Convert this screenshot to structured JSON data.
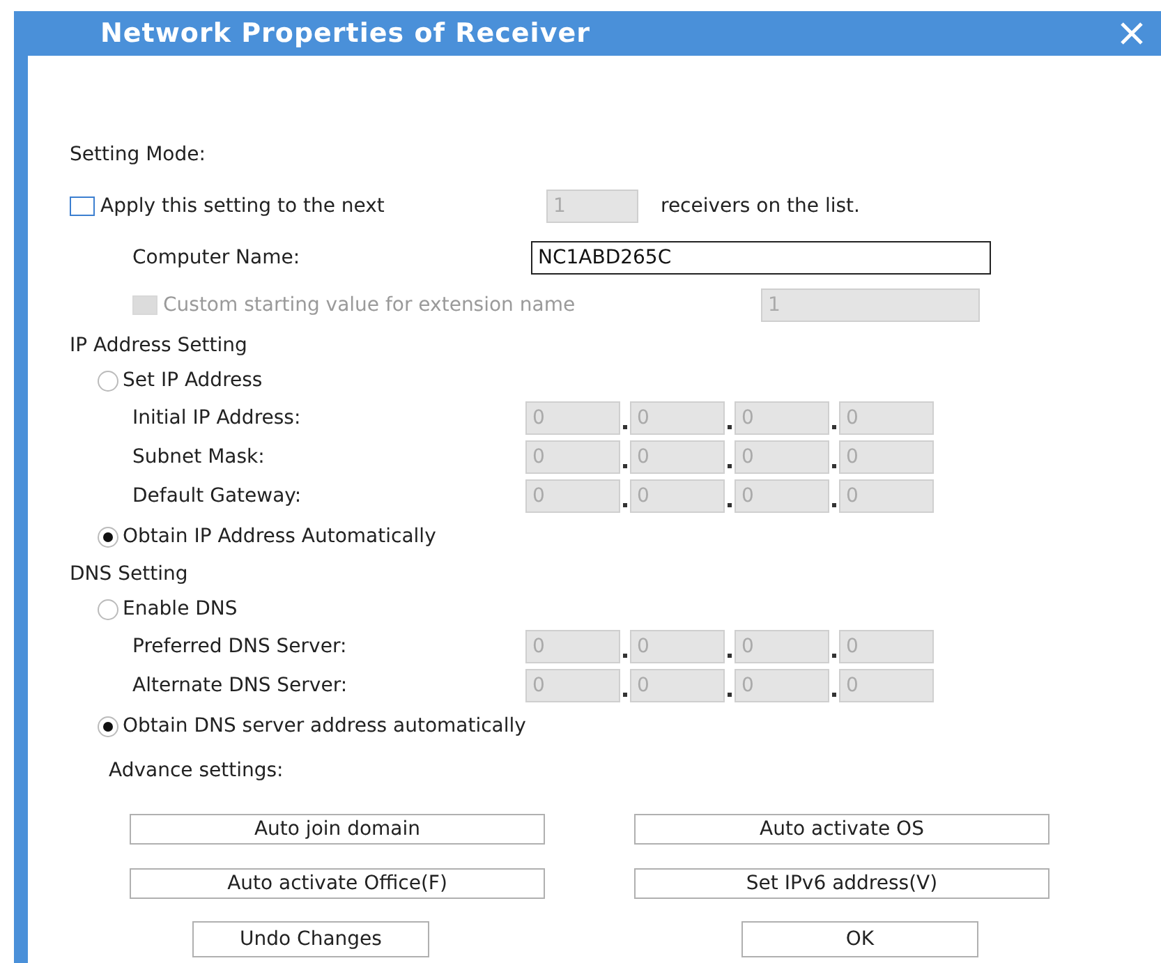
{
  "window": {
    "title": "Network Properties of Receiver"
  },
  "setting_mode": {
    "label": "Setting Mode:",
    "apply": {
      "checked": false,
      "label": "Apply this setting to the next",
      "count": "1",
      "count_disabled": true,
      "suffix": "receivers on the list."
    },
    "computer_name": {
      "label": "Computer Name:",
      "value": "NC1ABD265C"
    },
    "custom": {
      "checked": false,
      "disabled": true,
      "label": "Custom starting value for extension name",
      "value": "1"
    }
  },
  "sections": [
    {
      "heading": "IP Address Setting",
      "manual": {
        "label": "Set IP Address",
        "selected": false
      },
      "fields": [
        {
          "label": "Initial IP Address:",
          "disabled": true,
          "octets": [
            "0",
            "0",
            "0",
            "0"
          ]
        },
        {
          "label": "Subnet Mask:",
          "disabled": true,
          "octets": [
            "0",
            "0",
            "0",
            "0"
          ]
        },
        {
          "label": "Default Gateway:",
          "disabled": true,
          "octets": [
            "0",
            "0",
            "0",
            "0"
          ]
        }
      ],
      "auto": {
        "label": "Obtain IP Address Automatically",
        "selected": true
      }
    },
    {
      "heading": "DNS Setting",
      "manual": {
        "label": "Enable DNS",
        "selected": false
      },
      "fields": [
        {
          "label": "Preferred DNS Server:",
          "disabled": true,
          "octets": [
            "0",
            "0",
            "0",
            "0"
          ]
        },
        {
          "label": "Alternate DNS Server:",
          "disabled": true,
          "octets": [
            "0",
            "0",
            "0",
            "0"
          ]
        }
      ],
      "auto": {
        "label": "Obtain DNS server address automatically",
        "selected": true
      }
    }
  ],
  "advanced": {
    "label": "Advance settings:",
    "buttons": [
      "Auto join domain",
      "Auto activate OS",
      "Auto activate Office(F)",
      "Set IPv6 address(V)"
    ]
  },
  "footer_buttons": [
    "Undo Changes",
    "OK"
  ]
}
